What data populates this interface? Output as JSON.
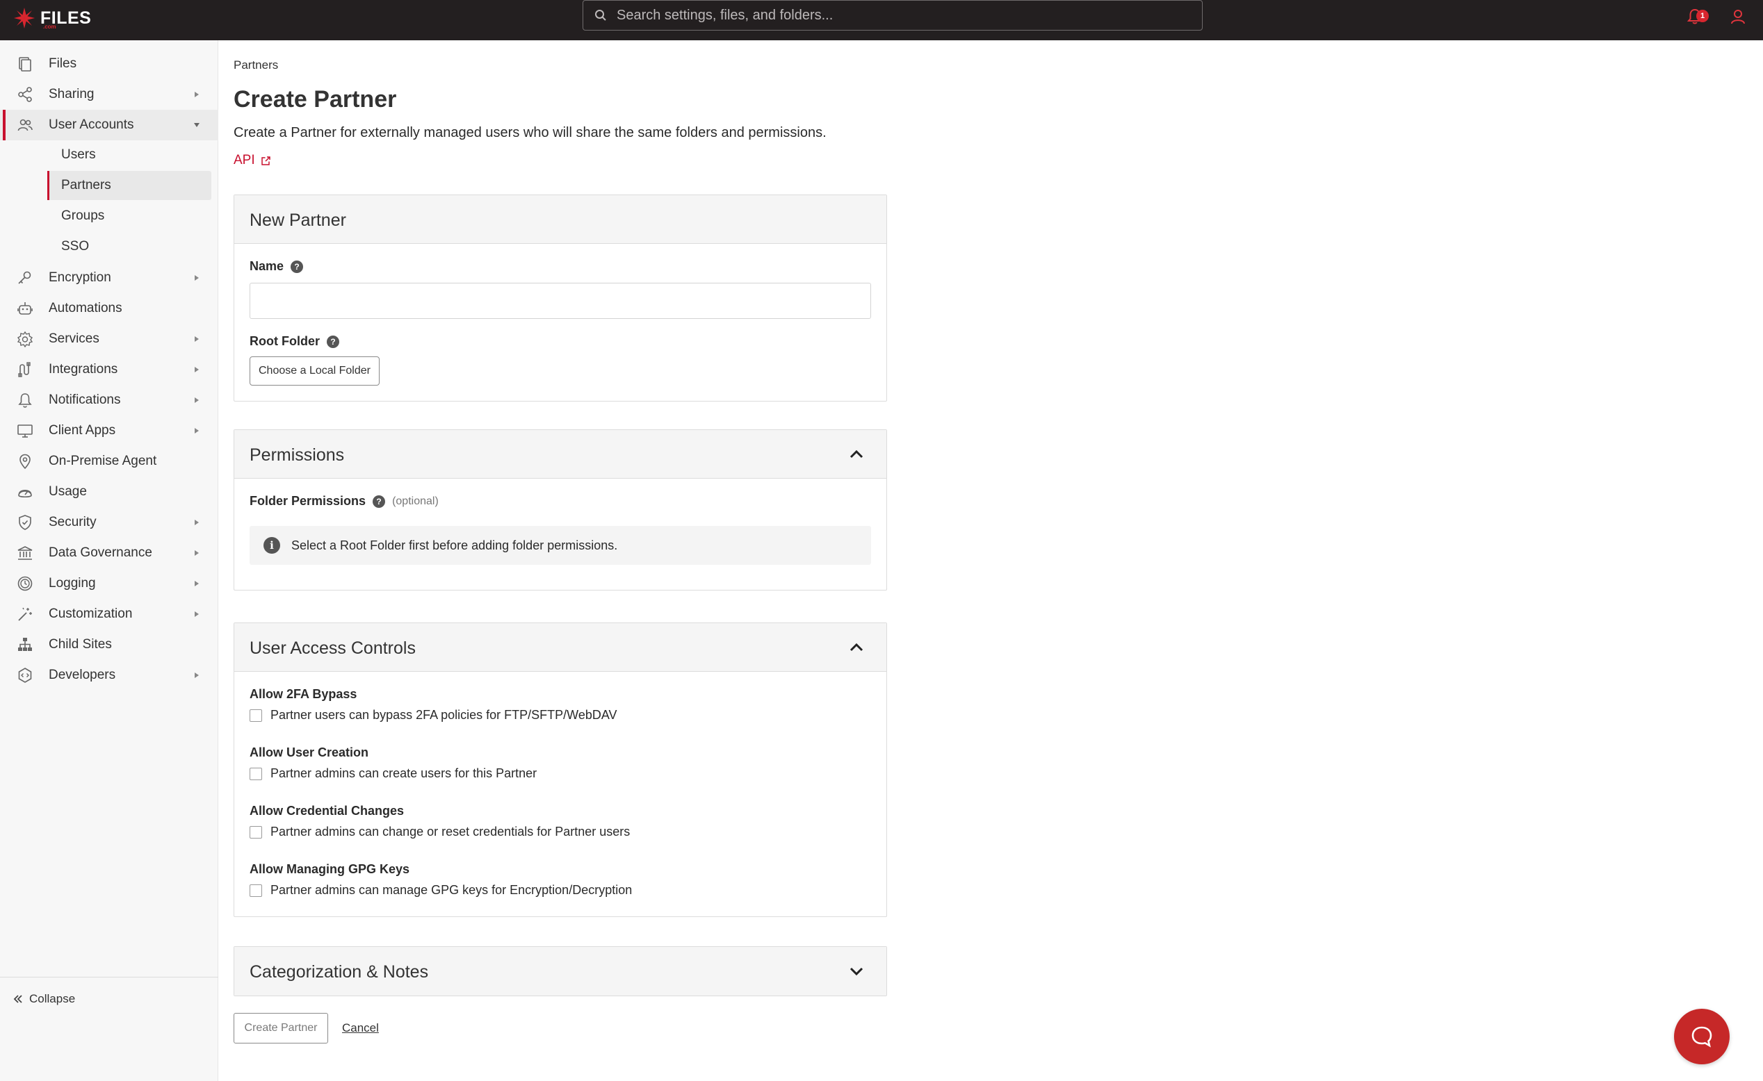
{
  "header": {
    "logo_text": "FILES",
    "logo_sub": ".com",
    "search_placeholder": "Search settings, files, and folders...",
    "notification_count": "1"
  },
  "sidebar": {
    "items": [
      {
        "label": "Files",
        "icon": "files-icon"
      },
      {
        "label": "Sharing",
        "icon": "share-icon"
      },
      {
        "label": "User Accounts",
        "icon": "users-icon"
      },
      {
        "label": "Encryption",
        "icon": "key-icon"
      },
      {
        "label": "Automations",
        "icon": "robot-icon"
      },
      {
        "label": "Services",
        "icon": "gear-icon"
      },
      {
        "label": "Integrations",
        "icon": "integrations-icon"
      },
      {
        "label": "Notifications",
        "icon": "bell-icon"
      },
      {
        "label": "Client Apps",
        "icon": "monitor-icon"
      },
      {
        "label": "On-Premise Agent",
        "icon": "location-pin-icon"
      },
      {
        "label": "Usage",
        "icon": "gauge-icon"
      },
      {
        "label": "Security",
        "icon": "shield-icon"
      },
      {
        "label": "Data Governance",
        "icon": "building-icon"
      },
      {
        "label": "Logging",
        "icon": "clock-icon"
      },
      {
        "label": "Customization",
        "icon": "magic-wand-icon"
      },
      {
        "label": "Child Sites",
        "icon": "sitemap-icon"
      },
      {
        "label": "Developers",
        "icon": "code-icon"
      }
    ],
    "sub_items": [
      {
        "label": "Users"
      },
      {
        "label": "Partners"
      },
      {
        "label": "Groups"
      },
      {
        "label": "SSO"
      }
    ],
    "collapse_label": "Collapse"
  },
  "main": {
    "breadcrumb": "Partners",
    "title": "Create Partner",
    "description": "Create a Partner for externally managed users who will share the same folders and permissions.",
    "api_link": "API",
    "new_partner": {
      "title": "New Partner",
      "name_label": "Name",
      "root_folder_label": "Root Folder",
      "choose_folder_button": "Choose a Local Folder"
    },
    "permissions": {
      "title": "Permissions",
      "folder_permissions_label": "Folder Permissions",
      "optional": "(optional)",
      "info_text": "Select a Root Folder first before adding folder permissions."
    },
    "user_access_controls": {
      "title": "User Access Controls",
      "controls": [
        {
          "title": "Allow 2FA Bypass",
          "checkbox_label": "Partner users can bypass 2FA policies for FTP/SFTP/WebDAV"
        },
        {
          "title": "Allow User Creation",
          "checkbox_label": "Partner admins can create users for this Partner"
        },
        {
          "title": "Allow Credential Changes",
          "checkbox_label": "Partner admins can change or reset credentials for Partner users"
        },
        {
          "title": "Allow Managing GPG Keys",
          "checkbox_label": "Partner admins can manage GPG keys for Encryption/Decryption"
        }
      ]
    },
    "categorization": {
      "title": "Categorization & Notes"
    },
    "create_button": "Create Partner",
    "cancel_link": "Cancel"
  },
  "colors": {
    "brand_red": "#c8102e",
    "topbar_bg": "#231f20"
  }
}
